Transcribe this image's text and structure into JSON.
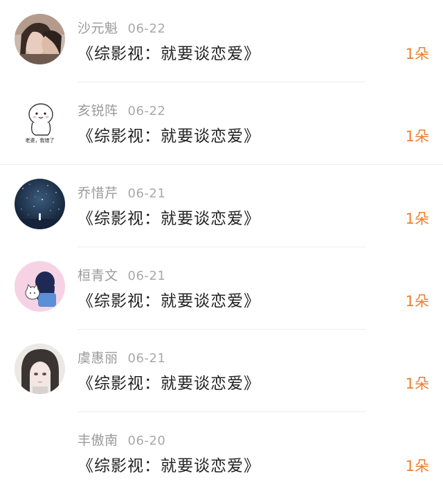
{
  "accent_color": "#f07e2c",
  "items": [
    {
      "name": "沙元魁",
      "date": "06-22",
      "title": "《综影视：就要谈恋爱》",
      "count": "1朵",
      "avatar": "photo-girl-avatar"
    },
    {
      "name": "亥锐阵",
      "date": "06-22",
      "title": "《综影视：就要谈恋爱》",
      "count": "1朵",
      "avatar": "cartoon-blob-avatar",
      "avatar_caption": "老婆，我错了"
    },
    {
      "name": "乔惜芹",
      "date": "06-21",
      "title": "《综影视：就要谈恋爱》",
      "count": "1朵",
      "avatar": "starry-night-avatar"
    },
    {
      "name": "桓青文",
      "date": "06-21",
      "title": "《综影视：就要谈恋爱》",
      "count": "1朵",
      "avatar": "illustrated-girl-cat-avatar"
    },
    {
      "name": "虞惠丽",
      "date": "06-21",
      "title": "《综影视：就要谈恋爱》",
      "count": "1朵",
      "avatar": "anime-girl-avatar"
    },
    {
      "name": "丰傲南",
      "date": "06-20",
      "title": "《综影视：就要谈恋爱》",
      "count": "1朵",
      "avatar": "none"
    }
  ]
}
